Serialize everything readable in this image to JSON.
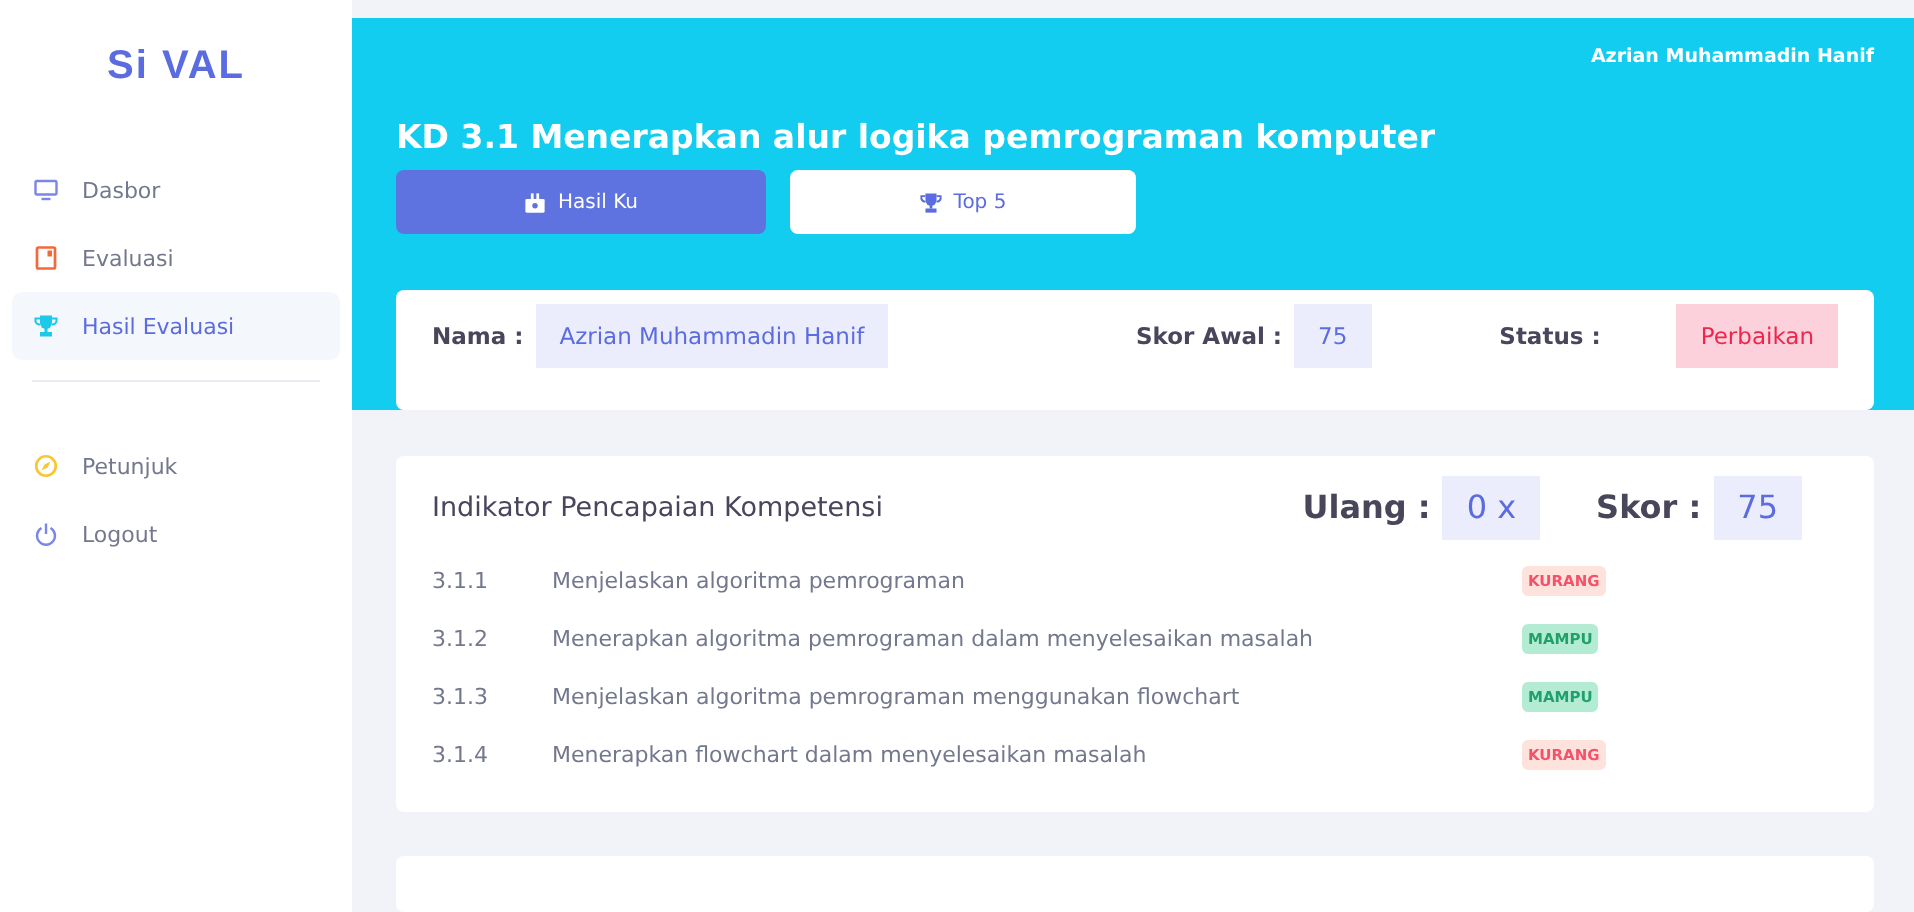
{
  "brand": "Si VAL",
  "sidebar": {
    "items": [
      {
        "label": "Dasbor",
        "selected": false
      },
      {
        "label": "Evaluasi",
        "selected": false
      },
      {
        "label": "Hasil Evaluasi",
        "selected": true
      },
      {
        "kind": "divider"
      },
      {
        "label": "Petunjuk",
        "selected": false
      },
      {
        "label": "Logout",
        "selected": false
      }
    ]
  },
  "user_name": "Azrian Muhammadin Hanif",
  "title": "KD 3.1  Menerapkan alur logika pemrograman komputer",
  "tabs": [
    {
      "label": "Hasil Ku",
      "selected": true
    },
    {
      "label": "Top 5",
      "selected": false
    }
  ],
  "info": [
    {
      "label": "Nama :",
      "value": "Azrian Muhammadin Hanif",
      "kind": "info"
    },
    {
      "label": "Skor Awal :",
      "value": "75",
      "kind": "info"
    },
    {
      "label": "Status :",
      "value": "Perbaikan",
      "kind": "danger"
    }
  ],
  "indicators": {
    "title": "Indikator Pencapaian Kompetensi",
    "stats": [
      {
        "label": "Ulang :",
        "value": "0 x"
      },
      {
        "label": "Skor :",
        "value": "75"
      }
    ],
    "rows": [
      {
        "code": "3.1.1",
        "text": "Menjelaskan algoritma pemrograman",
        "badge": "KURANG",
        "kind": "kurang"
      },
      {
        "code": "3.1.2",
        "text": "Menerapkan algoritma pemrograman dalam menyelesaikan masalah",
        "badge": "MAMPU",
        "kind": "mampu"
      },
      {
        "code": "3.1.3",
        "text": "Menjelaskan algoritma pemrograman menggunakan flowchart",
        "badge": "MAMPU",
        "kind": "mampu"
      },
      {
        "code": "3.1.4",
        "text": "Menerapkan flowchart dalam menyelesaikan masalah",
        "badge": "KURANG",
        "kind": "kurang"
      }
    ]
  }
}
